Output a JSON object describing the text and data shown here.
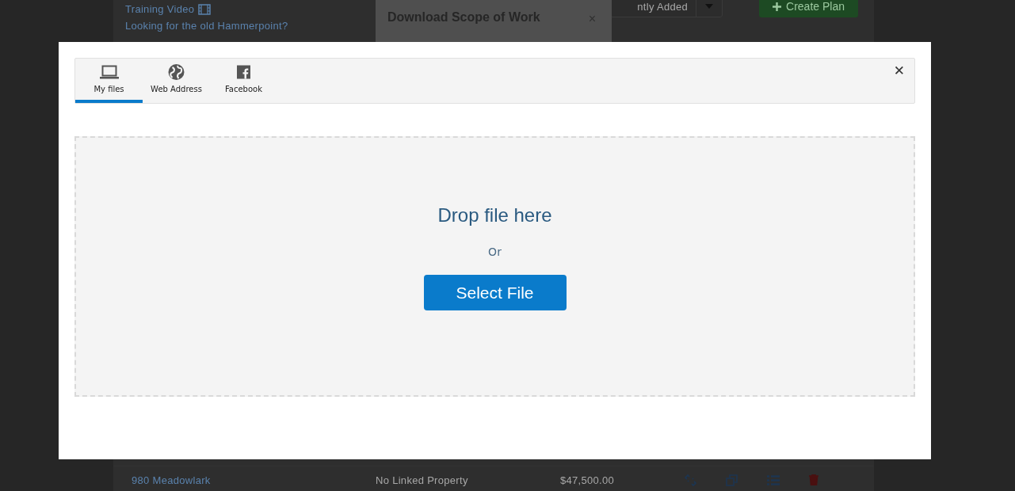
{
  "background_page": {
    "links": [
      {
        "text": "Training Video"
      },
      {
        "text": "Looking for the old Hammerpoint?"
      }
    ],
    "sort_select": {
      "value": "ntly Added"
    },
    "create_button": {
      "label": "Create Plan"
    },
    "row": {
      "name": "980 Meadowlark",
      "property": "No Linked Property",
      "amount": "$47,500.00"
    }
  },
  "background_dialog": {
    "title": "Download Scope of Work",
    "close": "×"
  },
  "modal": {
    "close": "✕",
    "tabs": [
      {
        "label": "My files",
        "selected": true
      },
      {
        "label": "Web Address",
        "selected": false
      },
      {
        "label": "Facebook",
        "selected": false
      }
    ],
    "dropzone": {
      "heading": "Drop file here",
      "separator": "Or",
      "button": "Select File"
    }
  }
}
